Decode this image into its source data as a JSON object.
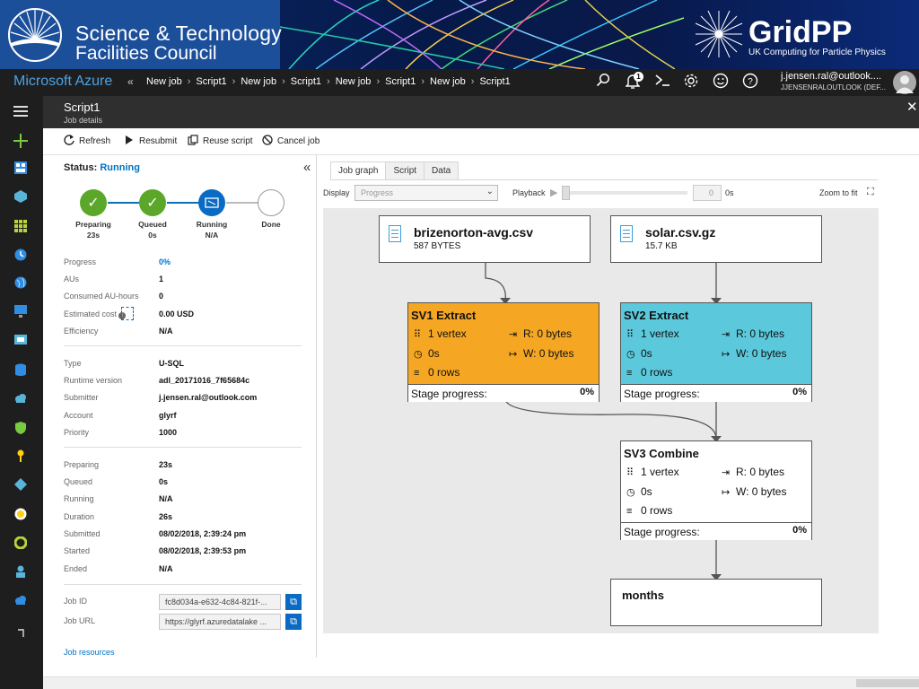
{
  "banner": {
    "stfc_line1": "Science & Technology",
    "stfc_line2": "Facilities Council",
    "gridpp_title": "GridPP",
    "gridpp_sub": "UK Computing for Particle Physics"
  },
  "topbar": {
    "brand": "Microsoft Azure",
    "collapse": "«",
    "breadcrumbs": [
      "New job",
      "Script1",
      "New job",
      "Script1",
      "New job",
      "Script1",
      "New job",
      "Script1"
    ],
    "crumb_sep": "›",
    "notification_count": "1",
    "user_email": "j.jensen.ral@outlook....",
    "user_dir": "JJENSENRALOUTLOOK (DEF..."
  },
  "blade": {
    "title": "Script1",
    "subtitle": "Job details",
    "close": "✕"
  },
  "toolbar": {
    "refresh": "Refresh",
    "resubmit": "Resubmit",
    "reuse": "Reuse script",
    "cancel": "Cancel job"
  },
  "status": {
    "label": "Status:",
    "value": "Running",
    "steps": [
      {
        "label": "Preparing",
        "sub": "23s",
        "state": "done"
      },
      {
        "label": "Queued",
        "sub": "0s",
        "state": "done"
      },
      {
        "label": "Running",
        "sub": "N/A",
        "state": "active"
      },
      {
        "label": "Done",
        "sub": "",
        "state": "pending"
      }
    ]
  },
  "props1": [
    {
      "k": "Progress",
      "v": "0%"
    },
    {
      "k": "AUs",
      "v": "1"
    },
    {
      "k": "Consumed AU-hours",
      "v": "0"
    },
    {
      "k": "Estimated cost",
      "v": "0.00 USD"
    },
    {
      "k": "Efficiency",
      "v": "N/A"
    }
  ],
  "props2": [
    {
      "k": "Type",
      "v": "U-SQL"
    },
    {
      "k": "Runtime version",
      "v": "adl_20171016_7f65684c"
    },
    {
      "k": "Submitter",
      "v": "j.jensen.ral@outlook.com"
    },
    {
      "k": "Account",
      "v": "glyrf"
    },
    {
      "k": "Priority",
      "v": "1000"
    }
  ],
  "props3": [
    {
      "k": "Preparing",
      "v": "23s"
    },
    {
      "k": "Queued",
      "v": "0s"
    },
    {
      "k": "Running",
      "v": "N/A"
    },
    {
      "k": "Duration",
      "v": "26s"
    },
    {
      "k": "Submitted",
      "v": "08/02/2018, 2:39:24 pm"
    },
    {
      "k": "Started",
      "v": "08/02/2018, 2:39:53 pm"
    },
    {
      "k": "Ended",
      "v": "N/A"
    }
  ],
  "job": {
    "id_label": "Job ID",
    "id_value": "fc8d034a-e632-4c84-821f-...",
    "url_label": "Job URL",
    "url_value": "https://glyrf.azuredatalake ...",
    "resources": "Job resources"
  },
  "tabs": [
    "Job graph",
    "Script",
    "Data"
  ],
  "controls": {
    "display_label": "Display",
    "display_value": "Progress",
    "playback_label": "Playback",
    "playback_value": "0",
    "playback_unit": "0s",
    "zoom_label": "Zoom to fit"
  },
  "graph": {
    "inputs": [
      {
        "name": "brizenorton-avg.csv",
        "size": "587 BYTES"
      },
      {
        "name": "solar.csv.gz",
        "size": "15.7 KB"
      }
    ],
    "stages": [
      {
        "name": "SV1 Extract",
        "color": "#f5a623",
        "vertex": "1 vertex",
        "read": "R: 0 bytes",
        "time": "0s",
        "write": "W: 0 bytes",
        "rows": "0 rows",
        "progress_label": "Stage progress:",
        "progress": "0%"
      },
      {
        "name": "SV2 Extract",
        "color": "#5bc8dc",
        "vertex": "1 vertex",
        "read": "R: 0 bytes",
        "time": "0s",
        "write": "W: 0 bytes",
        "rows": "0 rows",
        "progress_label": "Stage progress:",
        "progress": "0%"
      },
      {
        "name": "SV3 Combine",
        "color": "#ffffff",
        "vertex": "1 vertex",
        "read": "R: 0 bytes",
        "time": "0s",
        "write": "W: 0 bytes",
        "rows": "0 rows",
        "progress_label": "Stage progress:",
        "progress": "0%"
      }
    ],
    "output": {
      "name": "months"
    }
  },
  "colors": {
    "accent": "#0072c6",
    "dark": "#1e1e1e",
    "check": "#5aa72a"
  }
}
